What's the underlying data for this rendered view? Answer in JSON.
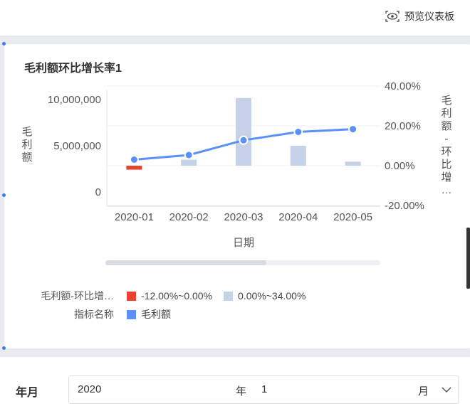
{
  "toolbar": {
    "preview_label": "预览仪表板",
    "preview_icon": "preview-eye-icon"
  },
  "card": {
    "title": "毛利额环比增长率1"
  },
  "chart_data": {
    "type": "bar-line-combo",
    "title": "毛利额环比增长率1",
    "xlabel": "日期",
    "categories": [
      "2020-01",
      "2020-02",
      "2020-03",
      "2020-04",
      "2020-05"
    ],
    "y_left": {
      "label": "毛利额",
      "ticks": [
        "10,000,000",
        "5,000,000",
        "0"
      ],
      "ylim": [
        0,
        10000000
      ]
    },
    "y_right": {
      "label": "毛利额-环比增…",
      "ticks": [
        "40.00%",
        "20.00%",
        "0.00%",
        "-20.00%"
      ],
      "ylim": [
        -20,
        40
      ]
    },
    "line_series": {
      "name": "毛利额",
      "color": "#5b8ff9",
      "values": [
        3500000,
        4000000,
        5600000,
        6500000,
        6800000
      ]
    },
    "bar_series": {
      "name": "毛利额-环比增…",
      "axis": "right",
      "values": [
        -2,
        3,
        34,
        10,
        2
      ]
    },
    "grid": true
  },
  "legend": {
    "rows": [
      {
        "label": "毛利额-环比增…",
        "items": [
          {
            "text": "-12.00%~0.00%",
            "color": "#e8432e"
          },
          {
            "text": "0.00%~34.00%",
            "color": "#c6d2e8"
          }
        ]
      },
      {
        "label": "指标名称",
        "items": [
          {
            "text": "毛利额",
            "color": "#5b8ff9"
          }
        ]
      }
    ]
  },
  "filter": {
    "label": "年月",
    "year": "2020",
    "year_unit": "年",
    "month": "1",
    "month_unit": "月"
  }
}
